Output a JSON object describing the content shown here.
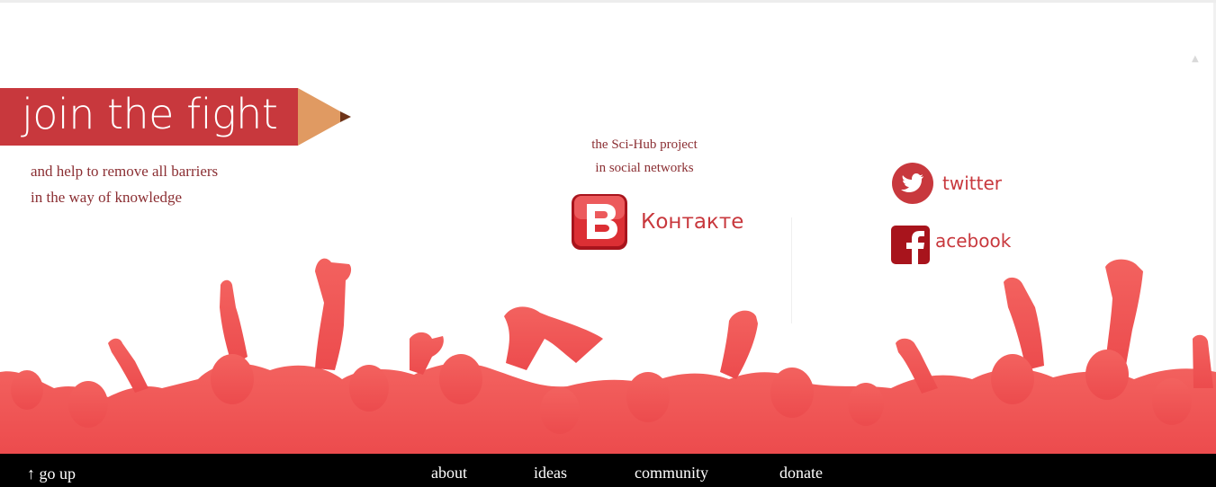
{
  "banner": {
    "title": "join the fight"
  },
  "subtitle": {
    "line1": "and help to remove all barriers",
    "line2": "in the way of knowledge"
  },
  "social": {
    "intro_line1": "the Sci-Hub project",
    "intro_line2": "in social networks",
    "vk": {
      "label": "Контакте",
      "icon": "vk-icon"
    },
    "twitter": {
      "label": "twitter",
      "icon": "twitter-bird-icon"
    },
    "facebook": {
      "label": "acebook",
      "icon": "facebook-f-icon"
    }
  },
  "footer": {
    "go_up": "↑ go up",
    "nav": [
      "about",
      "ideas",
      "community",
      "donate"
    ]
  },
  "colors": {
    "brand_red": "#c8383d",
    "text_red": "#8b2f33",
    "pencil_tip": "#e09a62",
    "crowd": "#ef5050",
    "footer_bg": "#000000"
  }
}
